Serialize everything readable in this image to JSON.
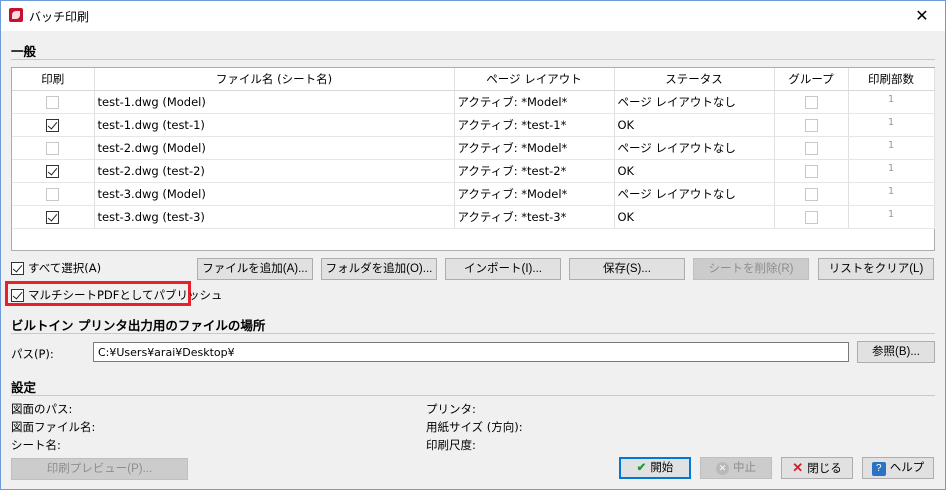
{
  "window": {
    "title": "バッチ印刷",
    "icons": {
      "app": "autocad-icon",
      "close": "close-icon"
    }
  },
  "general": {
    "section_title": "一般",
    "columns": [
      "印刷",
      "ファイル名 (シート名)",
      "ページ レイアウト",
      "ステータス",
      "グループ",
      "印刷部数"
    ],
    "rows": [
      {
        "print": false,
        "print_enabled": false,
        "file": "test-1.dwg (Model)",
        "layout": "アクティブ: *Model*",
        "status": "ページ レイアウトなし",
        "group": false,
        "copies": "1"
      },
      {
        "print": true,
        "print_enabled": true,
        "file": "test-1.dwg (test-1)",
        "layout": "アクティブ: *test-1*",
        "status": "OK",
        "group": false,
        "copies": "1"
      },
      {
        "print": false,
        "print_enabled": false,
        "file": "test-2.dwg (Model)",
        "layout": "アクティブ: *Model*",
        "status": "ページ レイアウトなし",
        "group": false,
        "copies": "1"
      },
      {
        "print": true,
        "print_enabled": true,
        "file": "test-2.dwg (test-2)",
        "layout": "アクティブ: *test-2*",
        "status": "OK",
        "group": false,
        "copies": "1"
      },
      {
        "print": false,
        "print_enabled": false,
        "file": "test-3.dwg (Model)",
        "layout": "アクティブ: *Model*",
        "status": "ページ レイアウトなし",
        "group": false,
        "copies": "1"
      },
      {
        "print": true,
        "print_enabled": true,
        "file": "test-3.dwg (test-3)",
        "layout": "アクティブ: *test-3*",
        "status": "OK",
        "group": false,
        "copies": "1"
      }
    ],
    "select_all": {
      "label": "すべて選択(A)",
      "checked": true
    },
    "multisheet": {
      "label": "マルチシートPDFとしてパブリッシュ",
      "checked": true
    },
    "buttons": {
      "add_file": "ファイルを追加(A)...",
      "add_folder": "フォルダを追加(O)...",
      "import": "インポート(I)...",
      "save": "保存(S)...",
      "remove_sheet": "シートを削除(R)",
      "clear_list": "リストをクリア(L)"
    }
  },
  "output": {
    "section_title": "ビルトイン プリンタ出力用のファイルの場所",
    "path_label": "パス(P):",
    "path_value": "C:¥Users¥arai¥Desktop¥",
    "browse": "参照(B)..."
  },
  "settings": {
    "section_title": "設定",
    "drawing_path": "図面のパス:",
    "drawing_file": "図面ファイル名:",
    "sheet_name": "シート名:",
    "printer": "プリンタ:",
    "paper_size": "用紙サイズ (方向):",
    "print_scale": "印刷尺度:"
  },
  "footer": {
    "preview": "印刷プレビュー(P)...",
    "start": "開始",
    "stop": "中止",
    "close": "閉じる",
    "help": "ヘルプ"
  },
  "colors": {
    "highlight": "#e8202a",
    "primary_border": "#0078d7"
  }
}
